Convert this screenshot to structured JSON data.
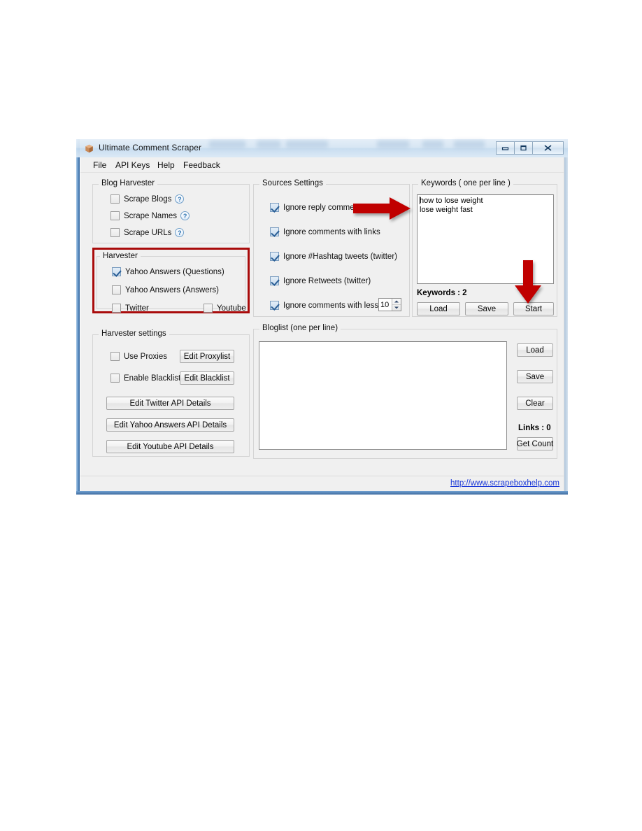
{
  "window": {
    "title": "Ultimate Comment Scraper",
    "icon": "app-box-icon",
    "controls": {
      "minimize": "─",
      "maximize": "□",
      "close": "✕"
    }
  },
  "menubar": {
    "items": [
      {
        "label": "File"
      },
      {
        "label": "API Keys"
      },
      {
        "label": "Help"
      },
      {
        "label": "Feedback"
      }
    ]
  },
  "blog_harvester": {
    "title": "Blog Harvester",
    "items": [
      {
        "label": "Scrape Blogs",
        "checked": false,
        "help": "?"
      },
      {
        "label": "Scrape Names",
        "checked": false,
        "help": "?"
      },
      {
        "label": "Scrape URLs",
        "checked": false,
        "help": "?"
      }
    ]
  },
  "harvester": {
    "title": "Harvester",
    "highlight_color": "#a90b0b",
    "items": [
      {
        "label": "Yahoo Answers (Questions)",
        "checked": true
      },
      {
        "label": "Yahoo Answers (Answers)",
        "checked": false
      },
      {
        "label": "Twitter",
        "checked": false
      },
      {
        "label": "Youtube",
        "checked": false
      }
    ]
  },
  "harvester_settings": {
    "title": "Harvester settings",
    "use_proxies": {
      "label": "Use Proxies",
      "checked": false
    },
    "enable_blacklist": {
      "label": "Enable Blacklist",
      "checked": false
    },
    "edit_proxylist": "Edit Proxylist",
    "edit_blacklist": "Edit Blacklist",
    "edit_twitter_api": "Edit Twitter API Details",
    "edit_yahoo_api": "Edit Yahoo Answers API Details",
    "edit_youtube_api": "Edit Youtube API Details"
  },
  "sources_settings": {
    "title": "Sources Settings",
    "items": [
      {
        "label": "Ignore reply comments",
        "checked": true
      },
      {
        "label": "Ignore comments with links",
        "checked": true
      },
      {
        "label": "Ignore #Hashtag tweets (twitter)",
        "checked": true
      },
      {
        "label": "Ignore Retweets (twitter)",
        "checked": true
      },
      {
        "label": "Ignore comments with less than",
        "checked": true
      }
    ],
    "min_words_value": "10"
  },
  "keywords": {
    "title": "Keywords ( one per line )",
    "text": "how to lose weight\nlose weight fast",
    "count_label": "Keywords : 2",
    "buttons": [
      {
        "label": "Load"
      },
      {
        "label": "Save"
      },
      {
        "label": "Start"
      }
    ]
  },
  "bloglist": {
    "title": "Bloglist (one per line)",
    "text": "",
    "buttons": [
      {
        "label": "Load"
      },
      {
        "label": "Save"
      },
      {
        "label": "Clear"
      }
    ],
    "links_label": "Links : 0",
    "get_count": "Get Count"
  },
  "statusbar": {
    "link": "http://www.scrapeboxhelp.com"
  },
  "annotations": {
    "arrow_right": "red-arrow-right",
    "arrow_down": "red-arrow-down"
  }
}
